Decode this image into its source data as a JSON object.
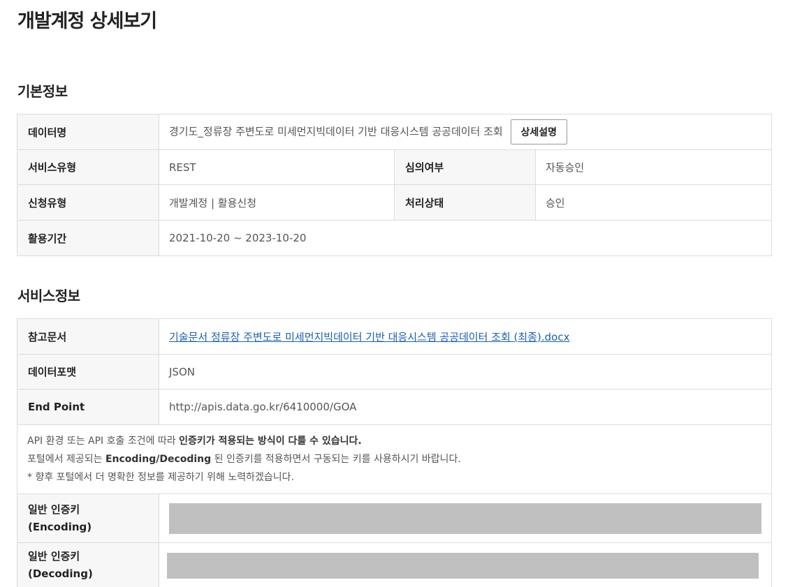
{
  "page_title": "개발계정 상세보기",
  "basic_section": {
    "title": "기본정보",
    "data_name_label": "데이터명",
    "data_name_value": "경기도_정류장 주변도로 미세먼지빅데이터 기반 대응시스템 공공데이터 조회",
    "detail_button": "상세설명",
    "service_type_label": "서비스유형",
    "service_type_value": "REST",
    "review_label": "심의여부",
    "review_value": "자동승인",
    "apply_type_label": "신청유형",
    "apply_type_value": "개발계정 | 활용신청",
    "status_label": "처리상태",
    "status_value": "승인",
    "period_label": "활용기간",
    "period_value": "2021-10-20 ~ 2023-10-20"
  },
  "service_section": {
    "title": "서비스정보",
    "ref_doc_label": "참고문서",
    "ref_doc_link": "기술문서 정류장 주변도로 미세먼지빅데이터 기반 대응시스템 공공데이터 조회 (최종).docx",
    "format_label": "데이터포맷",
    "format_value": "JSON",
    "endpoint_label": "End Point",
    "endpoint_value": "http://apis.data.go.kr/6410000/GOA",
    "notice": {
      "line1_a": "API 환경 또는 API 호출 조건에 따라 ",
      "line1_b": "인증키가 적용되는 방식이 다를 수 있습니다.",
      "line2_a": "포털에서 제공되는 ",
      "line2_b": "Encoding/Decoding",
      "line2_c": " 된 인증키를 적용하면서 구동되는 키를 사용하시기 바랍니다.",
      "line3": "* 향후 포털에서 더 명확한 정보를 제공하기 위해 노력하겠습니다."
    },
    "encoding_key_label_1": "일반 인증키",
    "encoding_key_label_2": "(Encoding)",
    "decoding_key_label_1": "일반 인증키",
    "decoding_key_label_2": "(Decoding)"
  },
  "colors": {
    "header_bg": "#f7f7f7",
    "border": "#dcdcdc",
    "link": "#1a5fb4",
    "mask": "#c0c0c0"
  }
}
